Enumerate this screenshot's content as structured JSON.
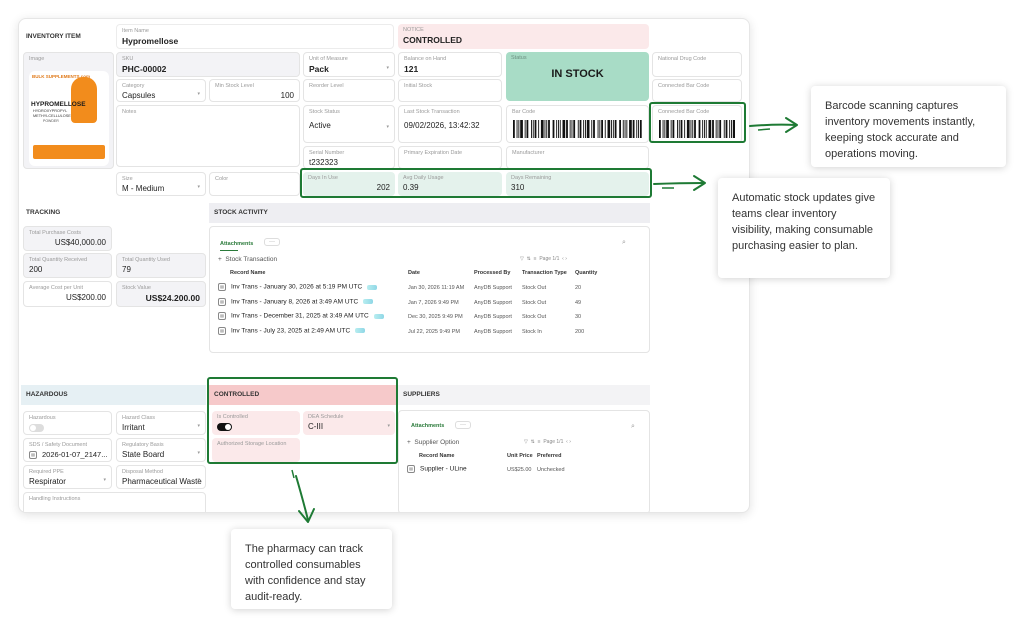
{
  "header": {
    "section_title": "INVENTORY ITEM",
    "item_name_label": "Item Name",
    "item_name": "Hypromellose",
    "notice_label": "NOTICE",
    "notice_value": "CONTROLLED"
  },
  "image": {
    "label": "Image",
    "brand": "BULK SUPPLEMENTS.com",
    "product": "HYPROMELLOSE",
    "sub1": "HYDROXYPROPYL",
    "sub2": "METHYLCELLULOSE",
    "form": "POWDER"
  },
  "fields": {
    "sku_label": "SKU",
    "sku": "PHC-00002",
    "uom_label": "Unit of Measure",
    "uom": "Pack",
    "balance_label": "Balance on Hand",
    "balance": "121",
    "status_label": "Status",
    "status": "IN STOCK",
    "ndc_label": "National Drug Code",
    "category_label": "Category",
    "category": "Capsules",
    "min_stock_label": "Min Stock Level",
    "min_stock": "100",
    "reorder_label": "Reorder Level",
    "initial_stock_label": "Initial Stock",
    "connected_barcode_label": "Connected Bar Code",
    "notes_label": "Notes",
    "stock_status_label": "Stock Status",
    "stock_status": "Active",
    "last_txn_label": "Last Stock Transaction",
    "last_txn": "09/02/2026, 13:42:32",
    "barcode_label": "Bar Code",
    "connected_barcode2_label": "Connected Bar Code",
    "serial_label": "Serial Number",
    "serial": "t232323",
    "primary_exp_label": "Primary Expiration Date",
    "manufacturer_label": "Manufacturer",
    "size_label": "Size",
    "size": "M - Medium",
    "color_label": "Color",
    "days_in_use_label": "Days In Use",
    "days_in_use": "202",
    "avg_daily_label": "Avg Daily Usage",
    "avg_daily": "0.39",
    "days_remaining_label": "Days Remaining",
    "days_remaining": "310"
  },
  "tracking": {
    "title": "TRACKING",
    "total_purchase_costs_label": "Total Purchase Costs",
    "total_purchase_costs": "US$40,000.00",
    "qty_received_label": "Total Quantity Received",
    "qty_received": "200",
    "qty_used_label": "Total Quantity Used",
    "qty_used": "79",
    "avg_cost_label": "Average Cost per Unit",
    "avg_cost": "US$200.00",
    "stock_value_label": "Stock Value",
    "stock_value": "US$24.200.00"
  },
  "stock_activity": {
    "title": "STOCK ACTIVITY",
    "tab_attachments": "Attachments",
    "tab_more": "···",
    "add_label": "Stock Transaction",
    "page_label": "Page 1/1",
    "columns": [
      "Record Name",
      "Date",
      "Processed By",
      "Transaction Type",
      "Quantity"
    ],
    "rows": [
      {
        "name": "Inv Trans - January 30, 2026 at 5:19 PM UTC",
        "date": "Jan 30, 2026 11:19 AM",
        "by": "AnyDB Support",
        "type": "Stock Out",
        "qty": "20"
      },
      {
        "name": "Inv Trans - January 8, 2026 at 3:49 AM UTC",
        "date": "Jan 7, 2026 9:49 PM",
        "by": "AnyDB Support",
        "type": "Stock Out",
        "qty": "49"
      },
      {
        "name": "Inv Trans - December 31, 2025 at 3:49 AM UTC",
        "date": "Dec 30, 2025 9:49 PM",
        "by": "AnyDB Support",
        "type": "Stock Out",
        "qty": "30"
      },
      {
        "name": "Inv Trans - July 23, 2025 at 2:49 AM UTC",
        "date": "Jul 22, 2025 9:49 PM",
        "by": "AnyDB Support",
        "type": "Stock In",
        "qty": "200"
      }
    ]
  },
  "hazardous": {
    "title": "HAZARDOUS",
    "hazardous_label": "Hazardous",
    "hazard_class_label": "Hazard Class",
    "hazard_class": "Irritant",
    "sds_label": "SDS / Safety Document",
    "sds": "2026-01-07_2147...",
    "reg_basis_label": "Regulatory Basis",
    "reg_basis": "State Board",
    "ppe_label": "Required PPE",
    "ppe": "Respirator",
    "disposal_label": "Disposal Method",
    "disposal": "Pharmaceutical Waste",
    "handling_label": "Handling Instructions"
  },
  "controlled": {
    "title": "CONTROLLED",
    "is_controlled_label": "Is Controlled",
    "dea_label": "DEA Schedule",
    "dea": "C-III",
    "storage_label": "Authorized Storage Location"
  },
  "suppliers": {
    "title": "SUPPLIERS",
    "tab_attachments": "Attachments",
    "tab_more": "···",
    "add_label": "Supplier Option",
    "page_label": "Page 1/1",
    "columns": [
      "Record Name",
      "Unit Price",
      "Preferred"
    ],
    "rows": [
      {
        "name": "Supplier - ULine",
        "price": "US$25.00",
        "preferred": "Unchecked"
      }
    ]
  },
  "callouts": {
    "barcode": "Barcode scanning captures inventory movements instantly, keeping stock accurate and operations moving.",
    "auto": "Automatic stock updates give teams clear inventory visibility, making consumable purchasing easier to plan.",
    "pharmacy": "The pharmacy can track controlled consumables with confidence and stay audit-ready."
  },
  "colors": {
    "accent_green": "#1e7a34",
    "status_green": "#a8dcc6",
    "notice_pink": "#fbe4e4"
  }
}
